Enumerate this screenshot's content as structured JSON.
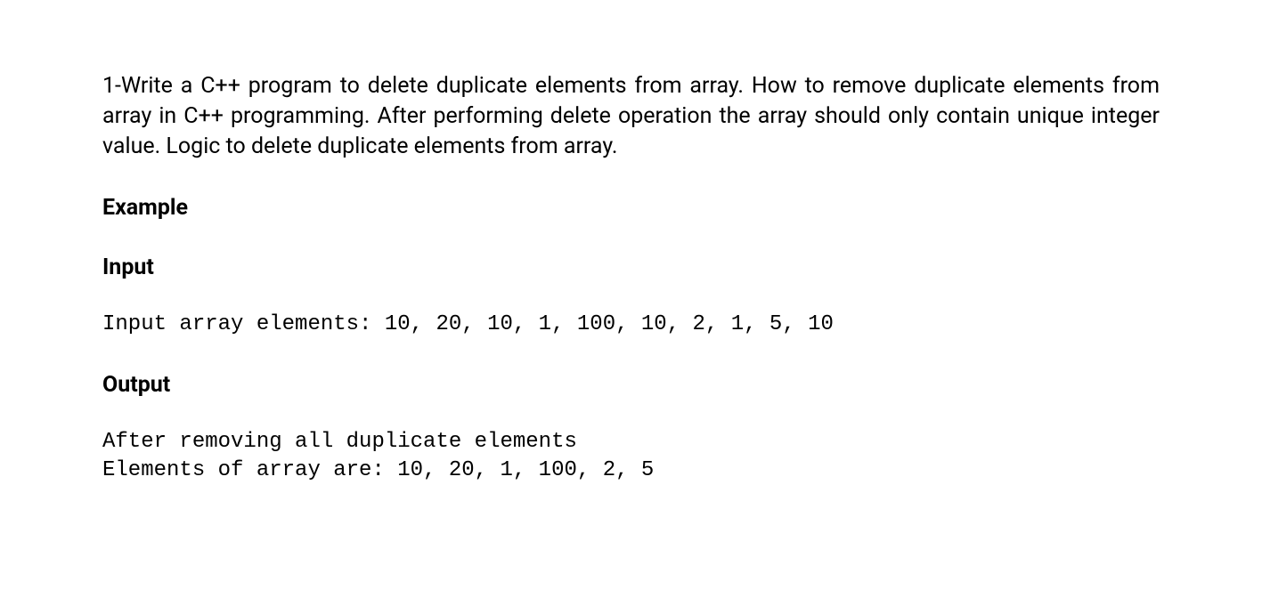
{
  "problem": {
    "description": "1-Write a C++ program to delete duplicate elements from array. How to remove duplicate elements from array in C++ programming. After performing delete operation the array should only contain unique integer value. Logic to delete duplicate elements from array."
  },
  "headings": {
    "example": "Example",
    "input": "Input",
    "output": "Output"
  },
  "example": {
    "input_text": "Input array elements: 10, 20, 10, 1, 100, 10, 2, 1, 5, 10",
    "output_line1": "After removing all duplicate elements",
    "output_line2": "Elements of array are: 10, 20, 1, 100, 2, 5"
  }
}
